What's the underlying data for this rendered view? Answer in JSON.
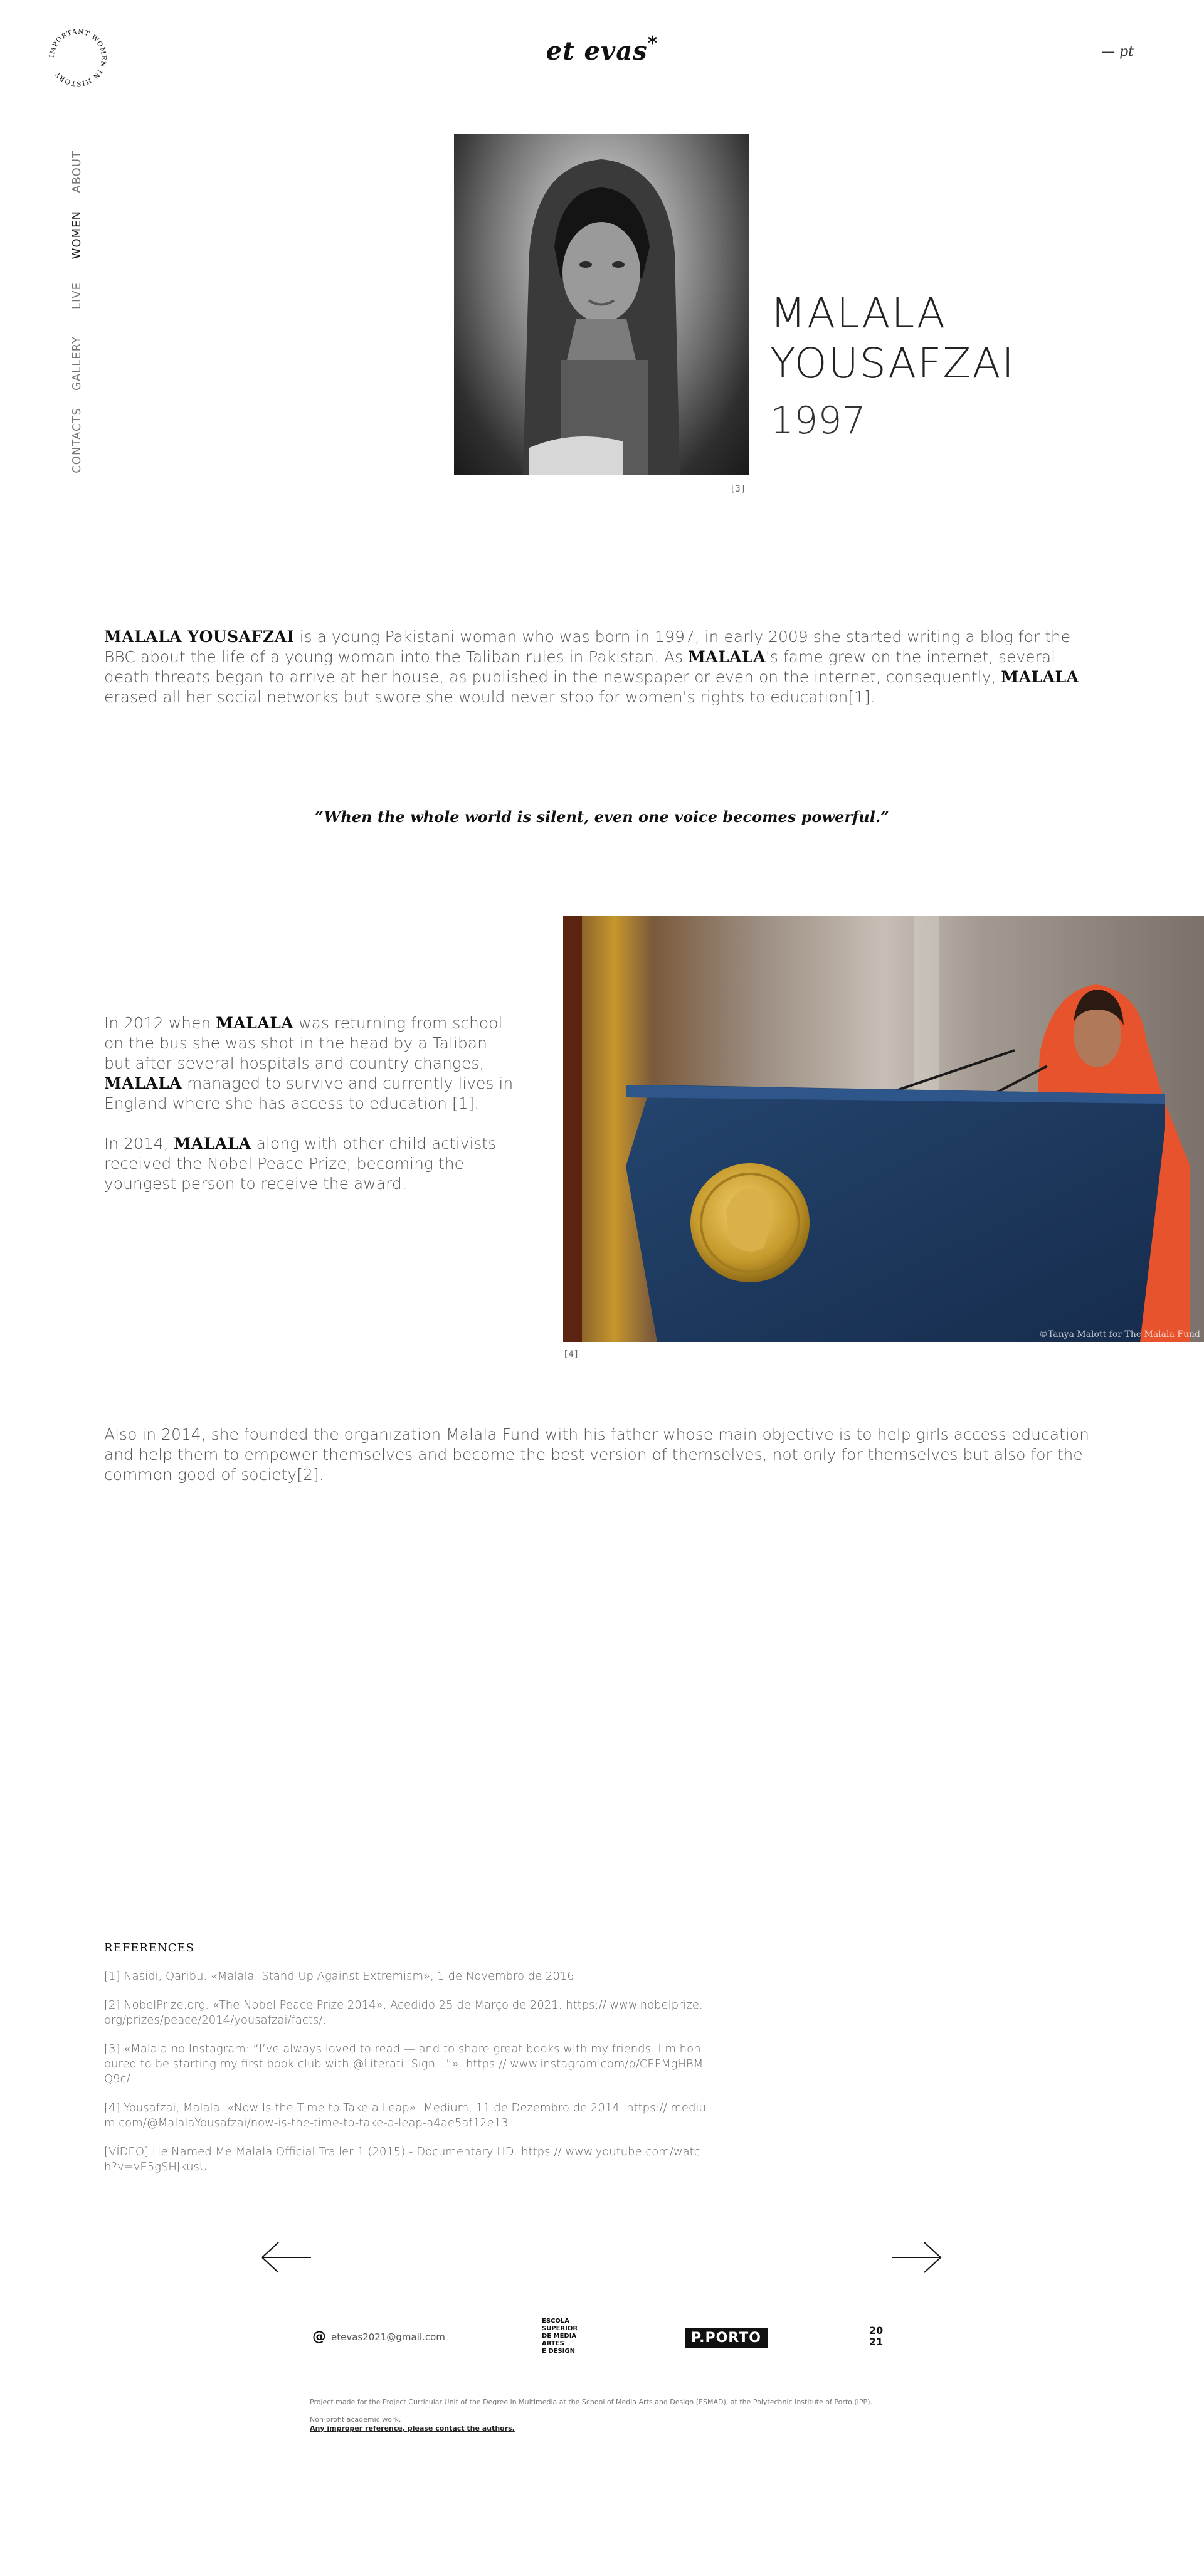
{
  "header": {
    "badge_text": "IMPORTANT WOMEN IN HISTORY",
    "brand": "et evas",
    "brand_mark": "*",
    "lang": "— pt"
  },
  "nav": {
    "items": [
      {
        "label": "ABOUT",
        "active": false
      },
      {
        "label": "WOMEN",
        "active": true
      },
      {
        "label": "LIVE",
        "active": false
      },
      {
        "label": "GALLERY",
        "active": false
      },
      {
        "label": "CONTACTS",
        "active": false
      }
    ]
  },
  "hero": {
    "name_line1": "MALALA",
    "name_line2": "YOUSAFZAI",
    "year": "1997",
    "photo_caption": "[3]"
  },
  "intro": {
    "name_full": "MALALA YOUSAFZAI",
    "text1": " is a young Pakistani woman who was born in 1997, in early 2009 she started writing a blog for the BBC about the life of a young woman into the Taliban rules in Pakistan. As ",
    "name1": "MALALA",
    "text2": "'s fame grew on the internet, several death threats began to arrive at her house, as published in the newspaper or even on the internet, consequently, ",
    "name2": "MALALA",
    "text3": " erased all her social networks but swore she would never stop for women's rights to education[1]."
  },
  "quote": "“When the whole world is silent, even one voice becomes powerful.”",
  "story": {
    "p1_a": "In 2012 when ",
    "p1_name": "MALALA",
    "p1_b": " was returning from school on the bus she was shot in the head by a Taliban but after several hospitals and country changes, ",
    "p1_name2": "MALALA",
    "p1_c": " managed to survive and currently lives in England where she has access to education [1].",
    "p2_a": "In 2014, ",
    "p2_name": "MALALA",
    "p2_b": " along with other child activists received the Nobel Peace Prize, becoming the youngest person to receive the award.",
    "photo_caption": "[4]",
    "photo_credit": "©Tanya Malott for The Malala Fund"
  },
  "fund_paragraph": "Also in 2014, she founded the organization Malala Fund with his father whose main objective is to help girls access education and help them to empower themselves and become the best version of themselves, not only for themselves but also for the common good of society[2].",
  "references": {
    "title": "REFERENCES",
    "items": [
      "[1] Nasidi, Qaribu. «Malala: Stand Up Against Extremism», 1 de Novembro de 2016.",
      "[2] NobelPrize.org. «The Nobel Peace Prize 2014». Acedido 25 de Março de 2021. https:// www.nobelprize.org/prizes/peace/2014/yousafzai/facts/.",
      "[3] «Malala no Instagram: “I’ve always loved to read — and to share great books with my friends. I’m honoured to be starting my first book club with @Literati. Sign...”». https:// www.instagram.com/p/CEFMgHBMQ9c/.",
      "[4] Yousafzai, Malala. «Now Is the Time to Take a Leap». Medium, 11 de Dezembro de 2014. https:// medium.com/@MalalaYousafzai/now-is-the-time-to-take-a-leap-a4ae5af12e13.",
      "[VÍDEO] He Named Me Malala Official Trailer 1 (2015) - Documentary HD. https:// www.youtube.com/watch?v=vE5gSHJkusU."
    ]
  },
  "footer": {
    "email": "etevas2021@gmail.com",
    "esmad_lines": [
      "ESCOLA",
      "SUPERIOR",
      "DE MEDIA",
      "ARTES",
      "E DESIGN"
    ],
    "pporto": "P.PORTO",
    "year_top": "20",
    "year_bottom": "21",
    "note": "Project made for the Project Curricular Unit of the Degree in Multimedia at the School of Media Arts and Design (ESMAD), at the Polytechnic Institute of Porto (IPP).",
    "nonprofit": "Non-profit academic work.",
    "contact_link": "Any improper reference, please contact the authors."
  }
}
